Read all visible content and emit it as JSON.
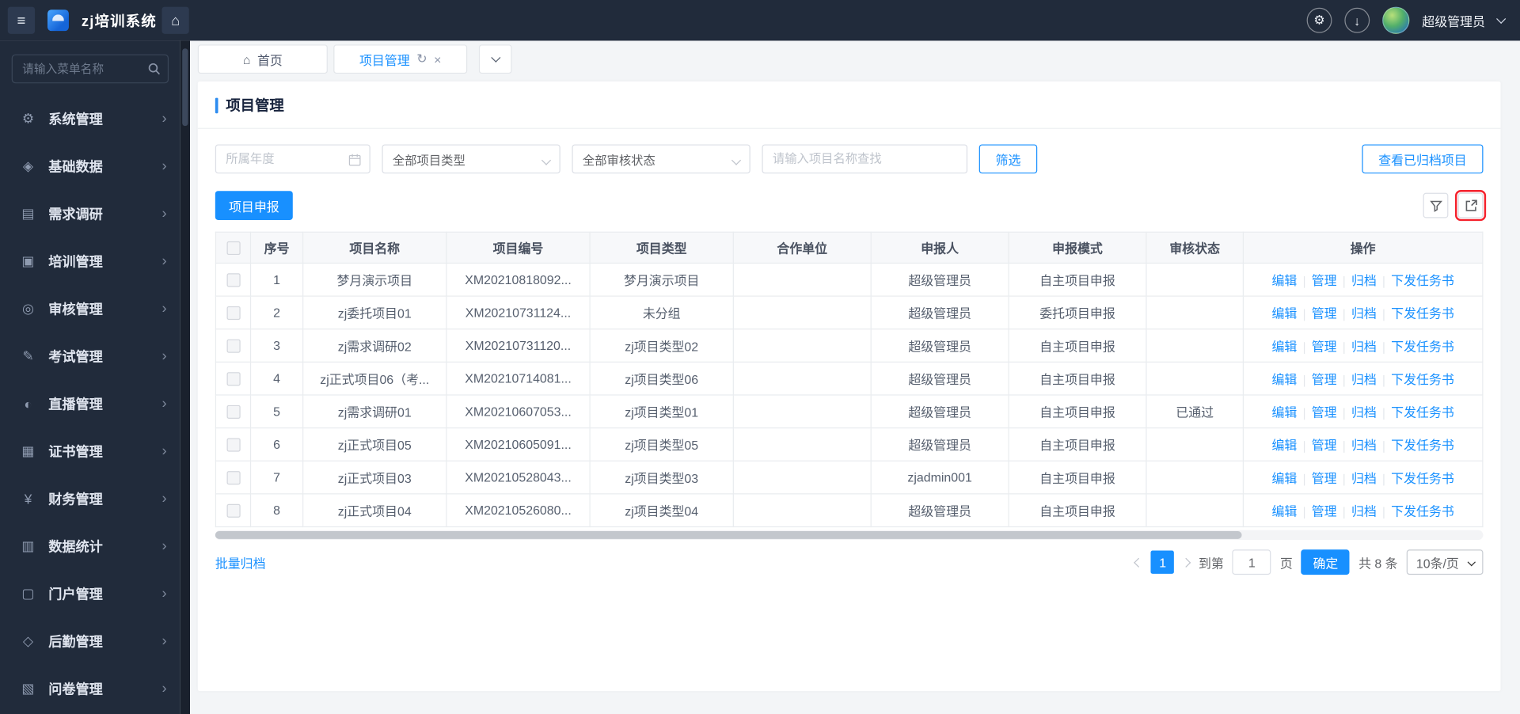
{
  "colors": {
    "accent": "#1890ff",
    "topbar_bg": "#212b3b",
    "highlight_box": "#f5222d"
  },
  "topbar": {
    "app_title": "zj培训系统",
    "user_name": "超级管理员",
    "glyphs": {
      "menu": "≡",
      "home": "⌂",
      "settings": "⚙",
      "download": "↓"
    }
  },
  "sidebar": {
    "search_placeholder": "请输入菜单名称",
    "chevron": "›",
    "items": [
      {
        "label": "系统管理",
        "icon": "gear-icon",
        "glyph": "⚙"
      },
      {
        "label": "基础数据",
        "icon": "database-icon",
        "glyph": "◈"
      },
      {
        "label": "需求调研",
        "icon": "survey-doc-icon",
        "glyph": "▤"
      },
      {
        "label": "培训管理",
        "icon": "training-icon",
        "glyph": "▣"
      },
      {
        "label": "审核管理",
        "icon": "audit-icon",
        "glyph": "◎"
      },
      {
        "label": "考试管理",
        "icon": "exam-icon",
        "glyph": "✎"
      },
      {
        "label": "直播管理",
        "icon": "live-icon",
        "glyph": "◐"
      },
      {
        "label": "证书管理",
        "icon": "certificate-icon",
        "glyph": "▦"
      },
      {
        "label": "财务管理",
        "icon": "finance-icon",
        "glyph": "¥"
      },
      {
        "label": "数据统计",
        "icon": "statistics-icon",
        "glyph": "▥"
      },
      {
        "label": "门户管理",
        "icon": "portal-icon",
        "glyph": "▢"
      },
      {
        "label": "后勤管理",
        "icon": "logistics-icon",
        "glyph": "◇"
      },
      {
        "label": "问卷管理",
        "icon": "questionnaire-icon",
        "glyph": "▧"
      }
    ]
  },
  "tabs": {
    "home_label": "首页",
    "home_glyph": "⌂",
    "current_label": "项目管理",
    "refresh_glyph": "↻",
    "close_glyph": "×"
  },
  "page": {
    "title": "项目管理"
  },
  "filters": {
    "year_placeholder": "所属年度",
    "type_value": "全部项目类型",
    "status_value": "全部审核状态",
    "search_placeholder": "请输入项目名称查找",
    "filter_button": "筛选",
    "view_archived_button": "查看已归档项目"
  },
  "toolbar": {
    "apply_button": "项目申报"
  },
  "table": {
    "headers": [
      "序号",
      "项目名称",
      "项目编号",
      "项目类型",
      "合作单位",
      "申报人",
      "申报模式",
      "审核状态",
      "操作"
    ],
    "actions": [
      "编辑",
      "管理",
      "归档",
      "下发任务书"
    ],
    "rows": [
      {
        "no": "1",
        "name": "梦月演示项目",
        "code": "XM20210818092...",
        "type": "梦月演示项目",
        "partner": "",
        "applicant": "超级管理员",
        "mode": "自主项目申报",
        "status": ""
      },
      {
        "no": "2",
        "name": "zj委托项目01",
        "code": "XM20210731124...",
        "type": "未分组",
        "partner": "",
        "applicant": "超级管理员",
        "mode": "委托项目申报",
        "status": ""
      },
      {
        "no": "3",
        "name": "zj需求调研02",
        "code": "XM20210731120...",
        "type": "zj项目类型02",
        "partner": "",
        "applicant": "超级管理员",
        "mode": "自主项目申报",
        "status": ""
      },
      {
        "no": "4",
        "name": "zj正式项目06（考...",
        "code": "XM20210714081...",
        "type": "zj项目类型06",
        "partner": "",
        "applicant": "超级管理员",
        "mode": "自主项目申报",
        "status": ""
      },
      {
        "no": "5",
        "name": "zj需求调研01",
        "code": "XM20210607053...",
        "type": "zj项目类型01",
        "partner": "",
        "applicant": "超级管理员",
        "mode": "自主项目申报",
        "status": "已通过"
      },
      {
        "no": "6",
        "name": "zj正式项目05",
        "code": "XM20210605091...",
        "type": "zj项目类型05",
        "partner": "",
        "applicant": "超级管理员",
        "mode": "自主项目申报",
        "status": ""
      },
      {
        "no": "7",
        "name": "zj正式项目03",
        "code": "XM20210528043...",
        "type": "zj项目类型03",
        "partner": "",
        "applicant": "zjadmin001",
        "mode": "自主项目申报",
        "status": ""
      },
      {
        "no": "8",
        "name": "zj正式项目04",
        "code": "XM20210526080...",
        "type": "zj项目类型04",
        "partner": "",
        "applicant": "超级管理员",
        "mode": "自主项目申报",
        "status": ""
      }
    ]
  },
  "pagination": {
    "batch_archive": "批量归档",
    "current_page": "1",
    "goto_prefix": "到第",
    "goto_value": "1",
    "goto_suffix": "页",
    "confirm_button": "确定",
    "total_text": "共 8 条",
    "page_size": "10条/页"
  }
}
